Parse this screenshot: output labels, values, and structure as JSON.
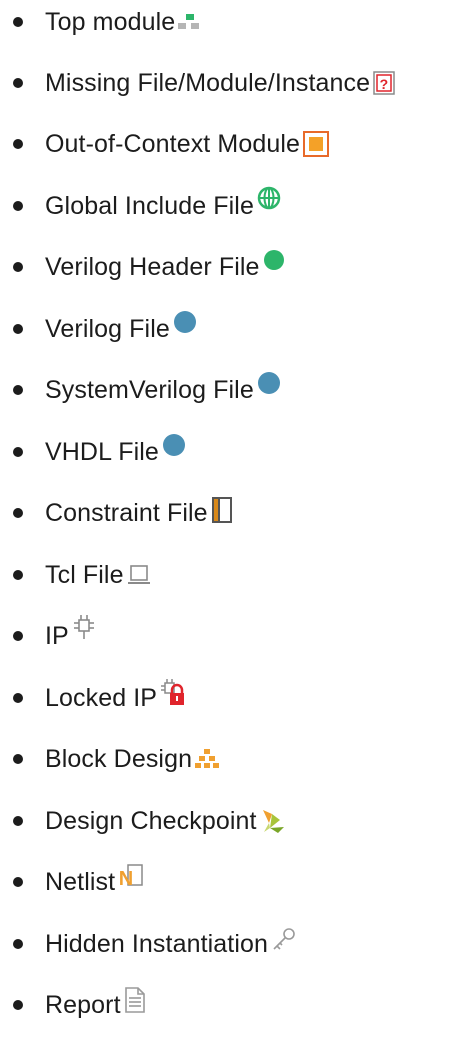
{
  "legend": {
    "items": [
      {
        "label": "Top module",
        "icon": "top-module-icon"
      },
      {
        "label": "Missing File/Module/Instance",
        "icon": "missing-file-icon"
      },
      {
        "label": "Out-of-Context Module",
        "icon": "ooc-module-icon"
      },
      {
        "label": "Global Include File",
        "icon": "globe-icon"
      },
      {
        "label": "Verilog Header File",
        "icon": "green-dot-icon"
      },
      {
        "label": "Verilog File",
        "icon": "blue-dot-icon"
      },
      {
        "label": "SystemVerilog File",
        "icon": "blue-dot-icon"
      },
      {
        "label": "VHDL File",
        "icon": "blue-dot-icon"
      },
      {
        "label": "Constraint File",
        "icon": "constraint-file-icon"
      },
      {
        "label": "Tcl File",
        "icon": "tcl-file-icon"
      },
      {
        "label": "IP",
        "icon": "ip-icon"
      },
      {
        "label": "Locked IP",
        "icon": "locked-ip-icon"
      },
      {
        "label": "Block Design",
        "icon": "block-design-icon"
      },
      {
        "label": "Design Checkpoint",
        "icon": "design-checkpoint-icon"
      },
      {
        "label": "Netlist",
        "icon": "netlist-icon"
      },
      {
        "label": "Hidden Instantiation",
        "icon": "key-icon"
      },
      {
        "label": "Report",
        "icon": "report-icon"
      }
    ]
  },
  "colors": {
    "text": "#1c1c1c",
    "green": "#2db56a",
    "blue": "#4a8fb4",
    "orange": "#f0a030",
    "red": "#e0242c",
    "gray": "#a8a8a8"
  }
}
